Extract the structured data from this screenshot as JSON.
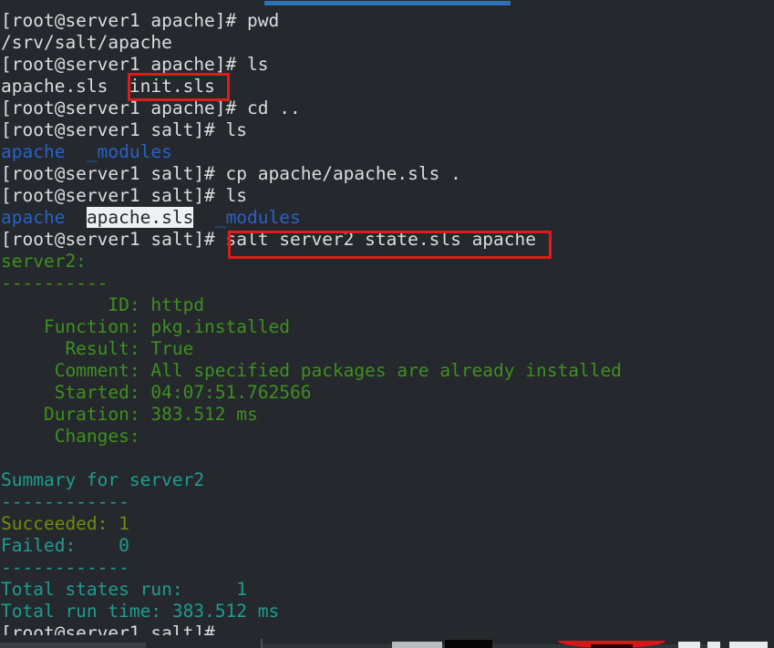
{
  "window": {
    "title": "terminal",
    "background_color": "#25292d",
    "top_bar": {
      "name": "progress-bar",
      "color": "#2d72b8"
    }
  },
  "terminal": {
    "prompt_apache": "[root@server1 apache]# ",
    "prompt_salt": "[root@server1 salt]# ",
    "colors": {
      "default_text": "#d9dde0",
      "green": "#3f8f1f",
      "teal": "#1f9c8f",
      "olive": "#6f8c11",
      "blue_dir": "#2761c7",
      "highlight_bg": "#eef1f3",
      "annotation_red": "#e01b1b"
    },
    "lines": [
      {
        "id": "l01",
        "prompt": "[root@server1 apache]# ",
        "command": "pwd"
      },
      {
        "id": "l02",
        "output": "/srv/salt/apache"
      },
      {
        "id": "l03",
        "prompt": "[root@server1 apache]# ",
        "command": "ls"
      },
      {
        "id": "l04",
        "file_a": "apache.sls",
        "gap": "  ",
        "file_b": "init.sls"
      },
      {
        "id": "l05",
        "prompt": "[root@server1 apache]# ",
        "command": "cd .."
      },
      {
        "id": "l06",
        "prompt": "[root@server1 salt]# ",
        "command": "ls"
      },
      {
        "id": "l07",
        "dir_a": "apache",
        "gap": "  ",
        "dir_b": "_modules"
      },
      {
        "id": "l08",
        "prompt": "[root@server1 salt]# ",
        "command": "cp apache/apache.sls ."
      },
      {
        "id": "l09",
        "prompt": "[root@server1 salt]# ",
        "command": "ls"
      },
      {
        "id": "l10",
        "dir_a": "apache",
        "gap": "  ",
        "file_hl": "apache.sls",
        "gap2": "  ",
        "dir_b": "_modules"
      },
      {
        "id": "l11",
        "prompt": "[root@server1 salt]# ",
        "command": "salt server2 state.sls apache"
      },
      {
        "id": "l12",
        "output": "server2:"
      },
      {
        "id": "l13",
        "output": "----------"
      },
      {
        "id": "l14",
        "output": "          ID: httpd"
      },
      {
        "id": "l15",
        "output": "    Function: pkg.installed"
      },
      {
        "id": "l16",
        "output": "      Result: True"
      },
      {
        "id": "l17",
        "output": "     Comment: All specified packages are already installed"
      },
      {
        "id": "l18",
        "output": "     Started: 04:07:51.762566"
      },
      {
        "id": "l19",
        "output": "    Duration: 383.512 ms"
      },
      {
        "id": "l20",
        "output": "     Changes:"
      },
      {
        "id": "l21",
        "output": ""
      },
      {
        "id": "l22",
        "output": "Summary for server2"
      },
      {
        "id": "l23",
        "output": "------------"
      },
      {
        "id": "l24",
        "output": "Succeeded: 1"
      },
      {
        "id": "l25",
        "output": "Failed:    0"
      },
      {
        "id": "l26",
        "output": "------------"
      },
      {
        "id": "l27",
        "output": "Total states run:     1"
      },
      {
        "id": "l28",
        "output": "Total run time: 383.512 ms"
      },
      {
        "id": "l29",
        "prompt": "[root@server1 salt]#",
        "command": ""
      }
    ]
  },
  "annotations": [
    {
      "id": "redbox-init",
      "target": "init.sls",
      "color": "#e01b1b"
    },
    {
      "id": "redbox-salt",
      "target": "salt server2 state.sls apache",
      "color": "#e01b1b"
    }
  ]
}
